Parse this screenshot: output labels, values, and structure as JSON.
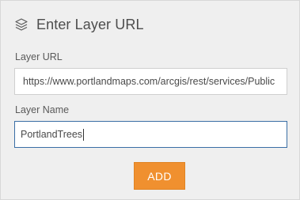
{
  "header": {
    "icon": "layers-icon",
    "title": "Enter Layer URL"
  },
  "layer_url": {
    "label": "Layer URL",
    "value": "https://www.portlandmaps.com/arcgis/rest/services/Public"
  },
  "layer_name": {
    "label": "Layer Name",
    "value": "PortlandTrees"
  },
  "actions": {
    "add_label": "ADD"
  },
  "colors": {
    "panel_bg": "#efefef",
    "button_bg": "#f0902f",
    "focus_border": "#3a6ea5"
  }
}
